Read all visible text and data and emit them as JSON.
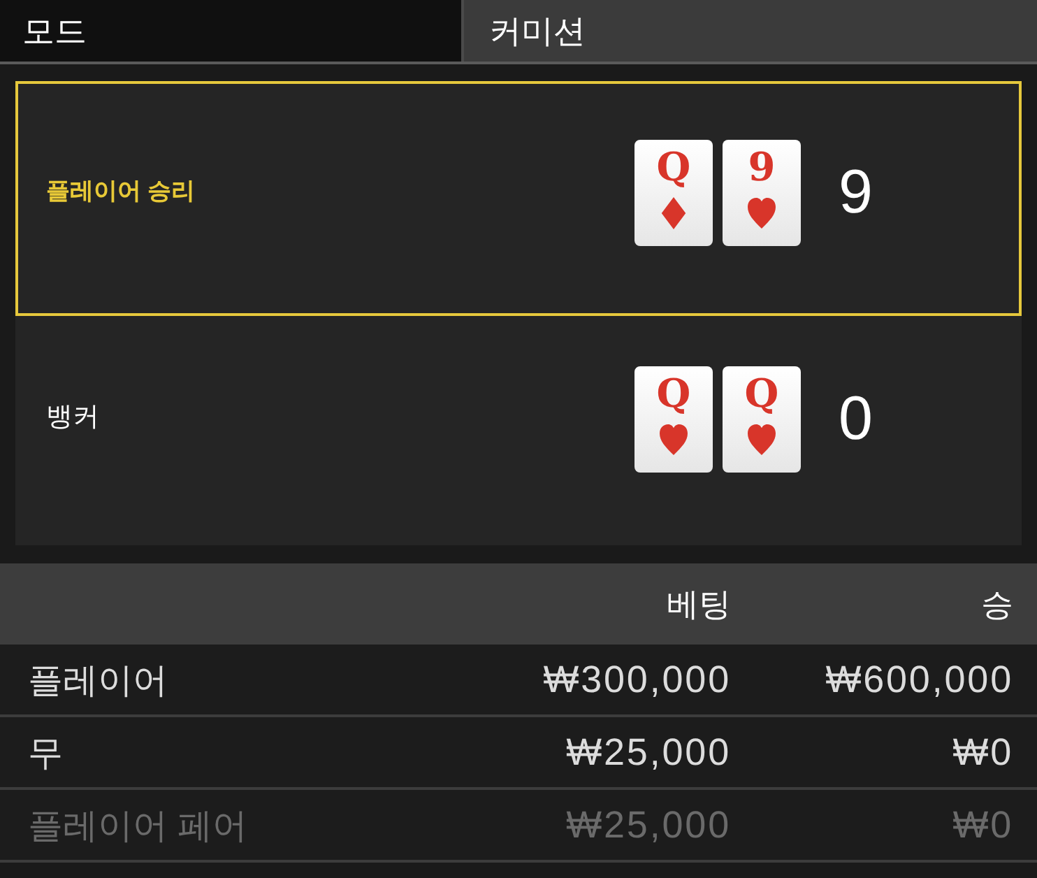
{
  "mode": {
    "label": "모드",
    "value": "커미션"
  },
  "hands": [
    {
      "name": "플레이어 승리",
      "winner": true,
      "cards": [
        {
          "rank": "Q",
          "kind": "diamond"
        },
        {
          "rank": "9",
          "kind": "heart"
        }
      ],
      "score": "9"
    },
    {
      "name": "뱅커",
      "winner": false,
      "cards": [
        {
          "rank": "Q",
          "kind": "heart"
        },
        {
          "rank": "Q",
          "kind": "heart"
        }
      ],
      "score": "0"
    }
  ],
  "bets": {
    "columns": [
      "베팅",
      "승"
    ],
    "rows": [
      {
        "name": "플레이어",
        "bet": "₩300,000",
        "win": "₩600,000",
        "dimmed": false
      },
      {
        "name": "무",
        "bet": "₩25,000",
        "win": "₩0",
        "dimmed": false
      },
      {
        "name": "플레이어 페어",
        "bet": "₩25,000",
        "win": "₩0",
        "dimmed": true
      }
    ]
  }
}
